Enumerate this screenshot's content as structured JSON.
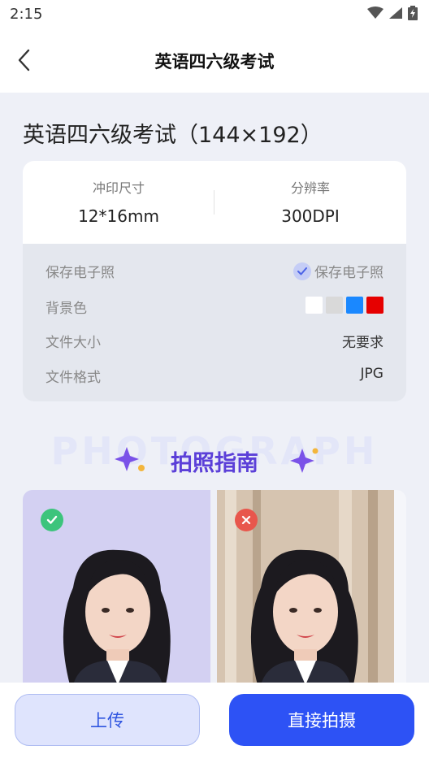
{
  "status": {
    "time": "2:15"
  },
  "header": {
    "title": "英语四六级考试"
  },
  "spec": {
    "title": "英语四六级考试（144×192）",
    "print_size_label": "冲印尺寸",
    "print_size_value": "12*16mm",
    "resolution_label": "分辨率",
    "resolution_value": "300DPI",
    "rows": {
      "save": {
        "label": "保存电子照",
        "value": "保存电子照"
      },
      "background": {
        "label": "背景色",
        "colors": [
          "#ffffff",
          "#d9d9d9",
          "#1a88ff",
          "#e60000"
        ]
      },
      "file_size": {
        "label": "文件大小",
        "value": "无要求"
      },
      "file_format": {
        "label": "文件格式",
        "value": "JPG"
      }
    }
  },
  "guide": {
    "bg_text": "PHOTOGRAPH",
    "title": "拍照指南"
  },
  "actions": {
    "upload": "上传",
    "shoot": "直接拍摄"
  },
  "colors": {
    "accent": "#2d52f5",
    "guide_purple": "#5b3fd8",
    "good": "#3cc47c",
    "bad": "#e8564c"
  }
}
